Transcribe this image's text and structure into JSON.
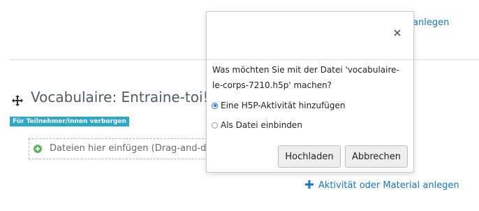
{
  "page": {
    "top_link": "anlegen",
    "section_title": "Vocabulaire: Entraine-toi!",
    "hidden_badge": "Für Teilnehmer/innen verborgen",
    "dropzone_text": "Dateien hier einfügen (Drag-and-drop)",
    "add_activity_label": "Aktivität oder Material anlegen"
  },
  "modal": {
    "question": "Was möchten Sie mit der Datei 'vocabulaire-le-corps-7210.h5p' machen?",
    "options": [
      {
        "label": "Eine H5P-Aktivität hinzufügen",
        "selected": true
      },
      {
        "label": "Als Datei einbinden",
        "selected": false
      }
    ],
    "upload_button": "Hochladen",
    "cancel_button": "Abbrechen"
  },
  "colors": {
    "link": "#1177d1",
    "badge": "#2aa7c9",
    "radio_selected": "#1a73e8"
  },
  "icons": [
    "move-icon",
    "add-file-icon",
    "plus-icon",
    "close-icon"
  ]
}
